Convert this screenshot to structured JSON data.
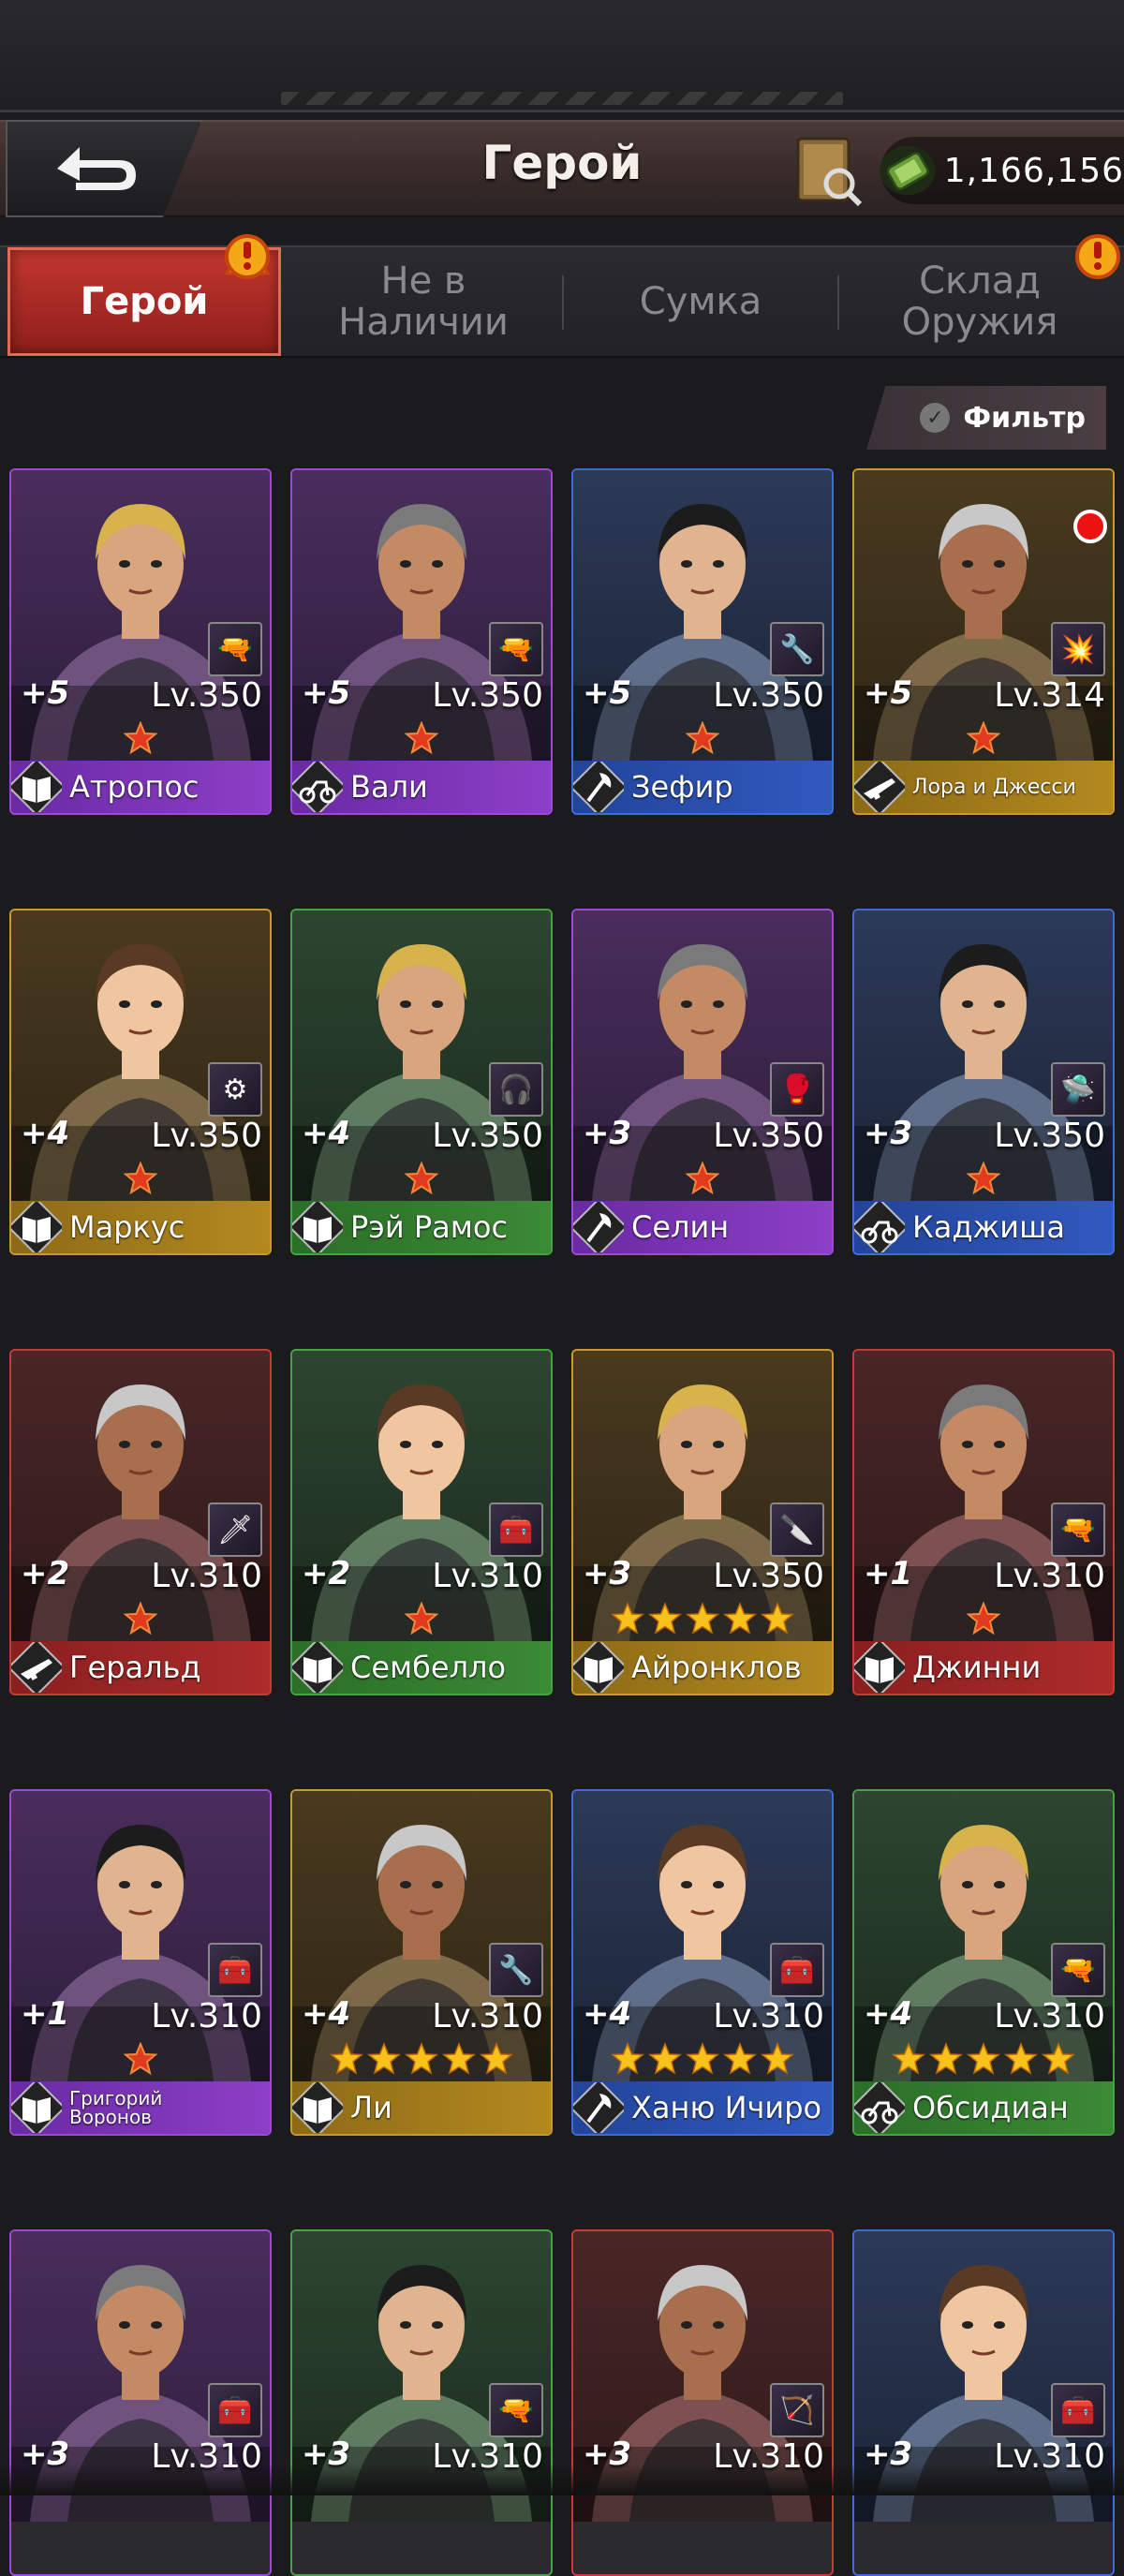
{
  "header": {
    "title": "Герой",
    "currency_amount": "1,166,156",
    "back_icon": "back-arrow-icon",
    "book_icon": "codex-book-icon",
    "currency_icon": "cash-bundle-icon"
  },
  "tabs": [
    {
      "label": "Герой",
      "active": true,
      "alert": true
    },
    {
      "label": "Не в Наличии",
      "active": false,
      "alert": false
    },
    {
      "label": "Сумка",
      "active": false,
      "alert": false
    },
    {
      "label": "Склад Оружия",
      "active": false,
      "alert": true
    }
  ],
  "filter": {
    "label": "Фильтр"
  },
  "colors": {
    "accent_red": "#c2362f",
    "purple": "#8c3fc7",
    "gold": "#b3891f",
    "blue": "#3159bf",
    "green": "#3b8a34",
    "red": "#ad2b2b"
  },
  "heroes": [
    {
      "name": "Атропос",
      "plus": "+5",
      "level": "Lv.350",
      "stars": 1,
      "rarity": "purple",
      "class_icon": "book-class-icon",
      "weapon_icon": "rifle-icon"
    },
    {
      "name": "Вали",
      "plus": "+5",
      "level": "Lv.350",
      "stars": 1,
      "rarity": "purple",
      "class_icon": "motorbike-class-icon",
      "weapon_icon": "gun-icon"
    },
    {
      "name": "Зефир",
      "plus": "+5",
      "level": "Lv.350",
      "stars": 1,
      "rarity": "blue",
      "class_icon": "axe-class-icon",
      "weapon_icon": "wrench-icon"
    },
    {
      "name": "Лора и Джесси",
      "plus": "+5",
      "level": "Lv.314",
      "stars": 1,
      "rarity": "gold",
      "class_icon": "rifle-class-icon",
      "weapon_icon": "launcher-icon",
      "notify": true
    },
    {
      "name": "Маркус",
      "plus": "+4",
      "level": "Lv.350",
      "stars": 1,
      "rarity": "gold",
      "class_icon": "book-class-icon",
      "weapon_icon": "gear-icon"
    },
    {
      "name": "Рэй Рамос",
      "plus": "+4",
      "level": "Lv.350",
      "stars": 1,
      "rarity": "green",
      "class_icon": "book-class-icon",
      "weapon_icon": "headphones-icon"
    },
    {
      "name": "Селин",
      "plus": "+3",
      "level": "Lv.350",
      "stars": 1,
      "rarity": "purple",
      "class_icon": "axe-class-icon",
      "weapon_icon": "gloves-icon"
    },
    {
      "name": "Каджиша",
      "plus": "+3",
      "level": "Lv.350",
      "stars": 1,
      "rarity": "blue",
      "class_icon": "motorbike-class-icon",
      "weapon_icon": "drone-icon"
    },
    {
      "name": "Геральд",
      "plus": "+2",
      "level": "Lv.310",
      "stars": 1,
      "rarity": "red",
      "class_icon": "rifle-class-icon",
      "weapon_icon": "sword-icon"
    },
    {
      "name": "Сембелло",
      "plus": "+2",
      "level": "Lv.310",
      "stars": 1,
      "rarity": "green",
      "class_icon": "book-class-icon",
      "weapon_icon": "chest-icon"
    },
    {
      "name": "Айронклов",
      "plus": "+3",
      "level": "Lv.350",
      "stars": 5,
      "rarity": "gold",
      "class_icon": "book-class-icon",
      "weapon_icon": "blade-icon"
    },
    {
      "name": "Джинни",
      "plus": "+1",
      "level": "Lv.310",
      "stars": 1,
      "rarity": "red",
      "class_icon": "book-class-icon",
      "weapon_icon": "rifle-icon"
    },
    {
      "name": "Григорий Воронов",
      "plus": "+1",
      "level": "Lv.310",
      "stars": 1,
      "rarity": "purple",
      "class_icon": "book-class-icon",
      "weapon_icon": "chest-icon"
    },
    {
      "name": "Ли",
      "plus": "+4",
      "level": "Lv.310",
      "stars": 5,
      "rarity": "gold",
      "class_icon": "book-class-icon",
      "weapon_icon": "wrench-icon"
    },
    {
      "name": "Ханю Ичиро",
      "plus": "+4",
      "level": "Lv.310",
      "stars": 5,
      "rarity": "blue",
      "class_icon": "axe-class-icon",
      "weapon_icon": "chest-icon"
    },
    {
      "name": "Обсидиан",
      "plus": "+4",
      "level": "Lv.310",
      "stars": 5,
      "rarity": "green",
      "class_icon": "motorbike-class-icon",
      "weapon_icon": "gun-icon"
    },
    {
      "name": "",
      "plus": "+3",
      "level": "Lv.310",
      "stars": 0,
      "rarity": "purple",
      "class_icon": "",
      "weapon_icon": "chest-icon"
    },
    {
      "name": "",
      "plus": "+3",
      "level": "Lv.310",
      "stars": 0,
      "rarity": "green",
      "class_icon": "",
      "weapon_icon": "rifle-icon"
    },
    {
      "name": "",
      "plus": "+3",
      "level": "Lv.310",
      "stars": 0,
      "rarity": "red",
      "class_icon": "",
      "weapon_icon": "bow-icon"
    },
    {
      "name": "",
      "plus": "+3",
      "level": "Lv.310",
      "stars": 0,
      "rarity": "blue",
      "class_icon": "",
      "weapon_icon": "chest-icon"
    }
  ]
}
